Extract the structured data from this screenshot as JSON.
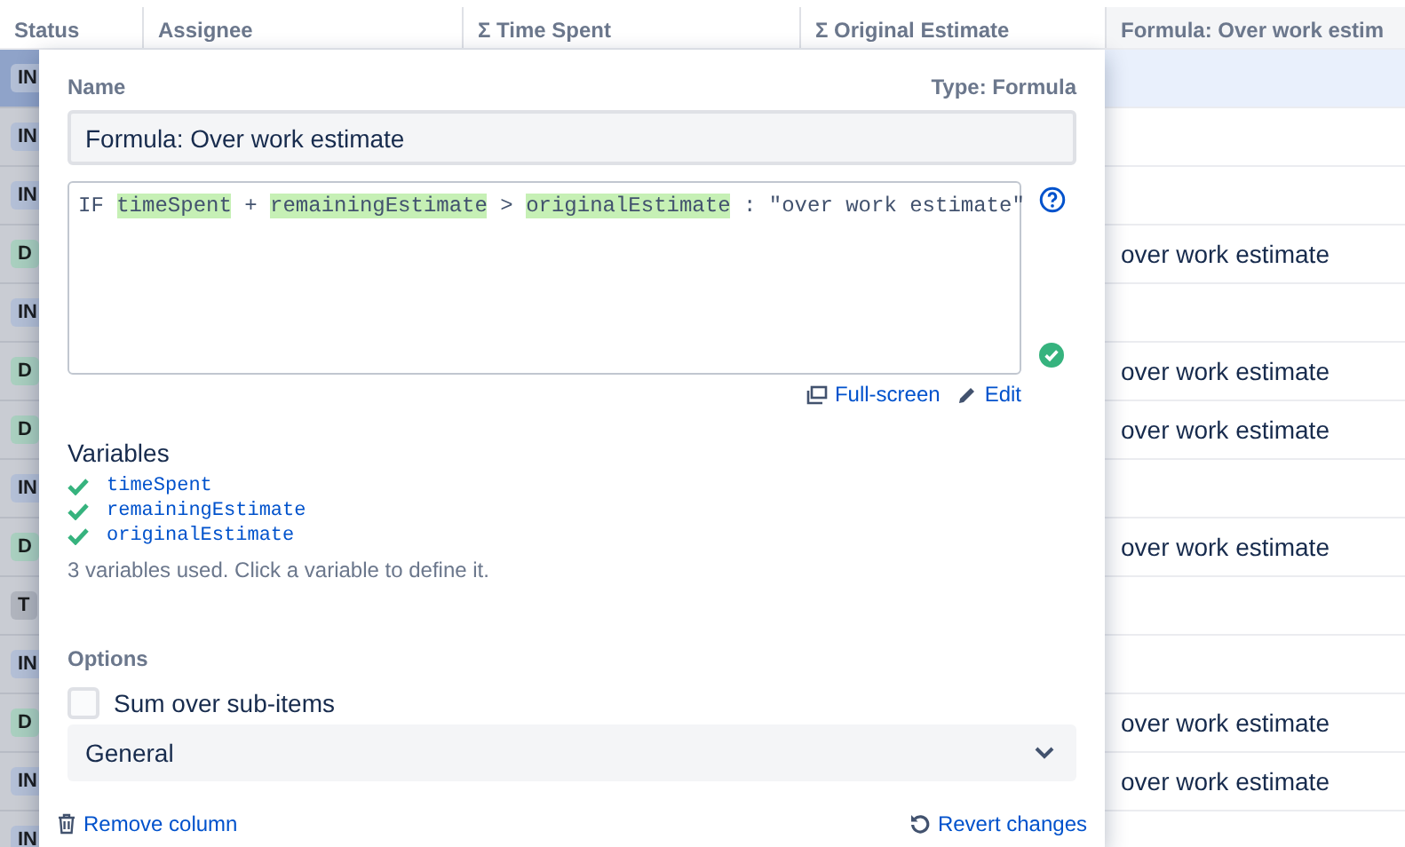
{
  "table": {
    "columns": [
      "Status",
      "Assignee",
      "Σ Time Spent",
      "Σ Original Estimate",
      "Formula: Over work estim"
    ],
    "rows": [
      {
        "status": "IN",
        "color": "#b3bfd6",
        "selected": true
      },
      {
        "status": "IN",
        "color": "#b3bfd6",
        "selected": false
      },
      {
        "status": "IN",
        "color": "#b3bfd6",
        "selected": false
      },
      {
        "status": "D",
        "color": "#a9cfbf",
        "selected": false,
        "formula": "over work estimate"
      },
      {
        "status": "IN",
        "color": "#b3bfd6",
        "selected": false
      },
      {
        "status": "D",
        "color": "#a9cfbf",
        "selected": false,
        "formula": "over work estimate"
      },
      {
        "status": "D",
        "color": "#a9cfbf",
        "selected": false,
        "formula": "over work estimate"
      },
      {
        "status": "IN",
        "color": "#b3bfd6",
        "selected": false
      },
      {
        "status": "D",
        "color": "#a9cfbf",
        "selected": false,
        "formula": "over work estimate"
      },
      {
        "status": "T",
        "color": "#b0b4bd",
        "selected": false
      },
      {
        "status": "IN",
        "color": "#b3bfd6",
        "selected": false
      },
      {
        "status": "D",
        "color": "#a9cfbf",
        "selected": false,
        "formula": "over work estimate"
      },
      {
        "status": "IN",
        "color": "#b3bfd6",
        "selected": false,
        "formula": "over work estimate"
      },
      {
        "status": "IN",
        "color": "#b3bfd6",
        "selected": false
      }
    ]
  },
  "panel": {
    "name_label": "Name",
    "type_label": "Type: Formula",
    "name_value": "Formula: Over work estimate",
    "formula": [
      {
        "text": "IF ",
        "kind": "plain"
      },
      {
        "text": "timeSpent",
        "kind": "variable"
      },
      {
        "text": " + ",
        "kind": "plain"
      },
      {
        "text": "remainingEstimate",
        "kind": "variable"
      },
      {
        "text": " > ",
        "kind": "plain"
      },
      {
        "text": "originalEstimate",
        "kind": "variable"
      },
      {
        "text": " : \"over work estimate\"",
        "kind": "plain"
      }
    ],
    "valid": true,
    "links": [
      "Full-screen",
      "Edit"
    ],
    "variables_heading": "Variables",
    "variables": [
      {
        "name": "timeSpent",
        "defined": true
      },
      {
        "name": "remainingEstimate",
        "defined": true
      },
      {
        "name": "originalEstimate",
        "defined": true
      }
    ],
    "variables_hint": "3 variables used. Click a variable to define it.",
    "options_heading": "Options",
    "sum_over_subitems": {
      "label": "Sum over sub-items",
      "checked": false
    },
    "format_select": "General",
    "remove_link": "Remove column",
    "revert_link": "Revert changes"
  }
}
